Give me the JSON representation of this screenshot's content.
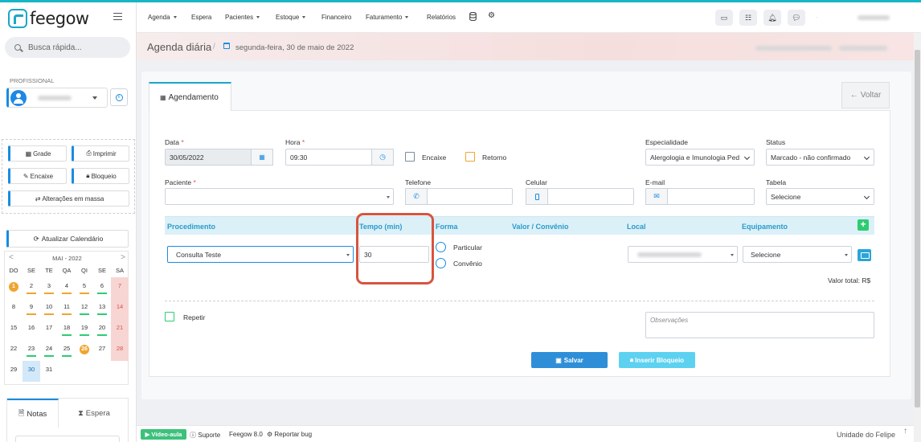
{
  "app": {
    "brand": "feegow",
    "accent": "#17b5c4"
  },
  "search": {
    "placeholder": "Busca rápida..."
  },
  "professional": {
    "label": "PROFISSIONAL"
  },
  "sidebar_buttons": {
    "grade": "Grade",
    "imprimir": "Imprimir",
    "encaixe": "Encaixe",
    "bloqueio": "Bloqueio",
    "alteracoes": "Alterações em massa",
    "atualizar": "Atualizar Calendário"
  },
  "calendar": {
    "month": "MAI - 2022",
    "prev": "<",
    "next": ">",
    "weekdays": [
      "DO",
      "SE",
      "TE",
      "QA",
      "QI",
      "SE",
      "SA"
    ],
    "weeks": [
      [
        "1",
        "2",
        "3",
        "4",
        "5",
        "6",
        "7"
      ],
      [
        "8",
        "9",
        "10",
        "11",
        "12",
        "13",
        "14"
      ],
      [
        "15",
        "16",
        "17",
        "18",
        "19",
        "20",
        "21"
      ],
      [
        "22",
        "23",
        "24",
        "25",
        "26",
        "27",
        "28"
      ],
      [
        "29",
        "30",
        "31",
        "",
        "",
        "",
        ""
      ]
    ],
    "selected": "30",
    "today": "26"
  },
  "notes_tabs": {
    "notas": "Notas",
    "espera": "Espera"
  },
  "nav": {
    "agenda": "Agenda",
    "espera": "Espera",
    "pacientes": "Pacientes",
    "estoque": "Estoque",
    "financeiro": "Financeiro",
    "faturamento": "Faturamento",
    "relatorios": "Relatórios"
  },
  "header": {
    "title": "Agenda diária",
    "separator": "/",
    "date": "segunda-feira, 30 de maio de 2022"
  },
  "tabs": {
    "agendamento": "Agendamento",
    "voltar": "Voltar"
  },
  "form": {
    "data_label": "Data",
    "data_value": "30/05/2022",
    "hora_label": "Hora",
    "hora_value": "09:30",
    "encaixe": "Encaixe",
    "retorno": "Retorno",
    "especialidade_label": "Especialidade",
    "especialidade_value": "Alergologia e Imunologia Ped",
    "status_label": "Status",
    "status_value": "Marcado - não confirmado",
    "paciente_label": "Paciente",
    "telefone_label": "Telefone",
    "celular_label": "Celular",
    "email_label": "E-mail",
    "tabela_label": "Tabela",
    "tabela_value": "Selecione",
    "required_mark": "*"
  },
  "procedures": {
    "headers": {
      "procedimento": "Procedimento",
      "tempo": "Tempo (min)",
      "forma": "Forma",
      "valor": "Valor / Convênio",
      "local": "Local",
      "equipamento": "Equipamento"
    },
    "add": "+",
    "procedimento_value": "Consulta Teste",
    "tempo_value": "30",
    "forma_particular": "Particular",
    "forma_convenio": "Convênio",
    "equipamento_value": "Selecione",
    "valor_total": "Valor total: R$"
  },
  "repeat": {
    "label": "Repetir"
  },
  "observacoes": {
    "placeholder": "Observações"
  },
  "actions": {
    "salvar": "Salvar",
    "bloqueio": "Inserir Bloqueio"
  },
  "footer": {
    "video": "Vídeo-aula",
    "suporte": "Suporte",
    "version": "Feegow 8.0",
    "bug": "Reportar bug",
    "unit": "Unidade do Felipe"
  }
}
